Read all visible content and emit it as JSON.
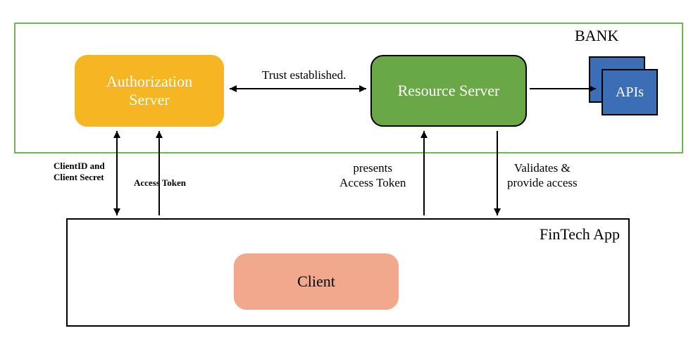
{
  "containers": {
    "bank_label": "BANK",
    "fintech_label": "FinTech App"
  },
  "nodes": {
    "auth_server": "Authorization\nServer",
    "resource_server": "Resource Server",
    "client": "Client",
    "apis": "APIs"
  },
  "edges": {
    "trust": "Trust established.",
    "client_id_secret": "ClientID and\nClient Secret",
    "access_token": "Access Token",
    "presents": "presents\nAccess Token",
    "validates": "Validates &\nprovide access"
  }
}
